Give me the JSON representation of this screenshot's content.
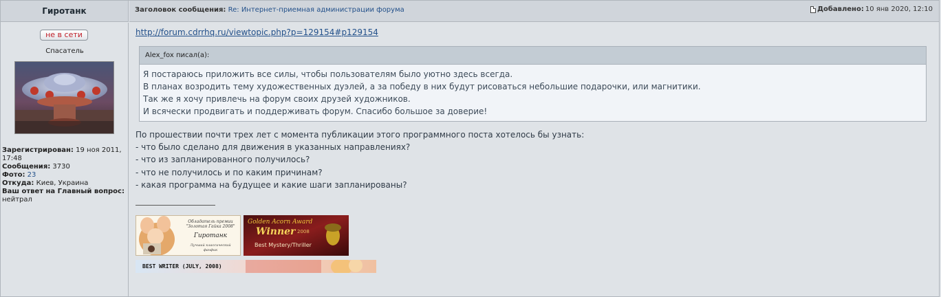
{
  "author": {
    "nickname": "Гиротанк",
    "status_badge": "не в сети",
    "rank": "Спасатель",
    "registered_label": "Зарегистрирован:",
    "registered_value": "19 ноя 2011, 17:48",
    "messages_label": "Сообщения:",
    "messages_value": "3730",
    "photos_label": "Фото:",
    "photos_value": "23",
    "from_label": "Откуда:",
    "from_value": "Киев, Украина",
    "answer_label": "Ваш ответ на Главный вопрос:",
    "answer_value": "нейтрал"
  },
  "header": {
    "subject_label": "Заголовок сообщения:",
    "subject_value": "Re: Интернет-приемная администрации форума",
    "posted_label": "Добавлено:",
    "posted_value": "10 янв 2020, 12:10"
  },
  "post": {
    "link": "http://forum.cdrrhq.ru/viewtopic.php?p=129154#p129154",
    "quote_author": "Alex_fox писал(а):",
    "quote_lines": [
      "Я постараюсь приложить все силы, чтобы пользователям было уютно здесь всегда.",
      "В планах возродить тему художественных дуэлей, а за победу в них будут рисоваться небольшие подарочки, или магнитики.",
      "Так же я хочу привлечь на форум своих друзей художников.",
      "И всячески продвигать и поддерживать форум. Спасибо большое за доверие!"
    ],
    "body_lines": [
      "По прошествии почти трех лет с момента публикации этого программного поста хотелось бы узнать:",
      "- что было сделано для движения в указанных направлениях?",
      "- что из запланированного получилось?",
      "- что не получилось и по каким причинам?",
      "- какая программа на будущее и какие шаги запланированы?"
    ]
  },
  "signature": {
    "banner1_lines": [
      "Обладатель премии",
      "\"Золотая Гайка 2008\"",
      "Гиротанк",
      "Лучший классический",
      "фанфик"
    ],
    "banner2_lines": [
      "Golden Acorn Award",
      "Winner",
      "2008",
      "Best Mystery/Thriller"
    ],
    "banner3_text": "BEST WRITER (JULY, 2008)"
  }
}
